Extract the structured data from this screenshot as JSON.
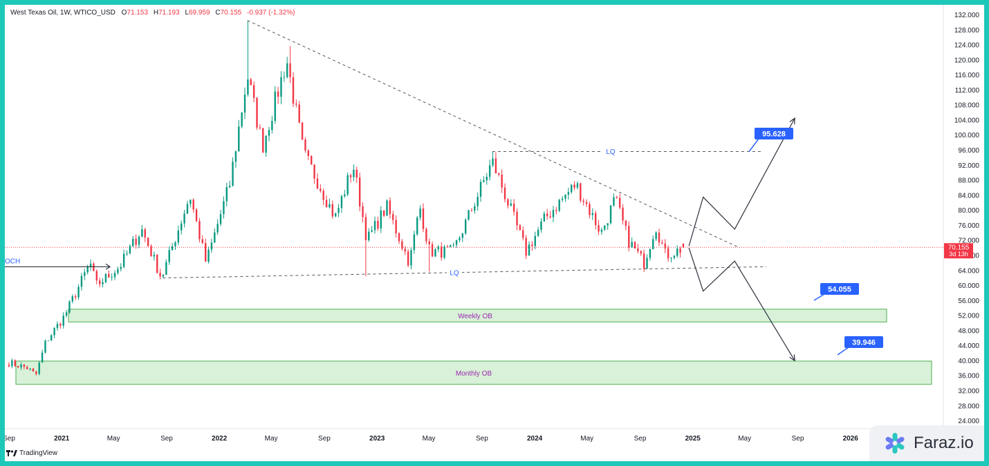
{
  "header": {
    "symbol": "West Texas Oil, 1W, WTICO_USD",
    "o_label": "O",
    "o_value": "71.153",
    "h_label": "H",
    "h_value": "71.193",
    "l_label": "L",
    "l_value": "69.959",
    "c_label": "C",
    "c_value": "70.155",
    "change": "-0.937 (-1.32%)"
  },
  "price_badge": {
    "price": "70.155",
    "countdown": "3d 13h"
  },
  "zones": {
    "weekly": {
      "label": "Weekly OB",
      "top": 53.7,
      "bottom": 50.3
    },
    "monthly": {
      "label": "Monthly OB",
      "top": 39.9,
      "bottom": 33.7
    }
  },
  "liquidity": {
    "upper_label": "LQ",
    "lower_label": "LQ"
  },
  "targets": [
    "95.628",
    "54.055",
    "39.946"
  ],
  "bos_label": "OCH",
  "brand": {
    "tradingview": "TradingView",
    "watermark": "Faraz.io"
  },
  "colors": {
    "up": "#089981",
    "down": "#f23645",
    "zone_fill": "#c8ebc8",
    "zone_border": "#4caf50",
    "label_blue": "#2962ff",
    "zone_text": "#9c27b0",
    "frame": "#1ec8b9"
  },
  "chart_data": {
    "type": "candlestick",
    "timeframe": "1W",
    "title": "West Texas Oil, 1W, WTICO_USD",
    "ylim": [
      20.8,
      133.3
    ],
    "y_ticks": [
      "132.000",
      "128.000",
      "124.000",
      "120.000",
      "116.000",
      "112.000",
      "108.000",
      "104.000",
      "100.000",
      "96.000",
      "92.000",
      "88.000",
      "84.000",
      "80.000",
      "76.000",
      "72.000",
      "68.000",
      "64.000",
      "60.000",
      "56.000",
      "52.000",
      "48.000",
      "44.000",
      "40.000",
      "36.000",
      "32.000",
      "28.000",
      "24.000"
    ],
    "x_ticks": [
      {
        "label": "Sep",
        "date": "2020-09-01"
      },
      {
        "label": "2021",
        "date": "2021-01-01"
      },
      {
        "label": "May",
        "date": "2021-05-01"
      },
      {
        "label": "Sep",
        "date": "2021-09-01"
      },
      {
        "label": "2022",
        "date": "2022-01-01"
      },
      {
        "label": "May",
        "date": "2022-05-01"
      },
      {
        "label": "Sep",
        "date": "2022-09-01"
      },
      {
        "label": "2023",
        "date": "2023-01-01"
      },
      {
        "label": "May",
        "date": "2023-05-01"
      },
      {
        "label": "Sep",
        "date": "2023-09-01"
      },
      {
        "label": "2024",
        "date": "2024-01-01"
      },
      {
        "label": "May",
        "date": "2024-05-01"
      },
      {
        "label": "Sep",
        "date": "2024-09-01"
      },
      {
        "label": "2025",
        "date": "2025-01-01"
      },
      {
        "label": "May",
        "date": "2025-05-01"
      },
      {
        "label": "Sep",
        "date": "2025-09-01"
      },
      {
        "label": "2026",
        "date": "2026-01-01"
      }
    ],
    "anchors": [
      {
        "date": "2020-09-01",
        "close": 39.5
      },
      {
        "date": "2020-10-15",
        "close": 38.0
      },
      {
        "date": "2020-11-02",
        "close": 36.0
      },
      {
        "date": "2020-11-25",
        "close": 45.0
      },
      {
        "date": "2021-01-08",
        "close": 52.0
      },
      {
        "date": "2021-03-08",
        "close": 66.0
      },
      {
        "date": "2021-03-22",
        "close": 60.0
      },
      {
        "date": "2021-05-15",
        "close": 65.0
      },
      {
        "date": "2021-07-05",
        "close": 75.0
      },
      {
        "date": "2021-08-20",
        "close": 62.0
      },
      {
        "date": "2021-10-25",
        "close": 84.0
      },
      {
        "date": "2021-12-01",
        "close": 66.0
      },
      {
        "date": "2022-01-25",
        "close": 87.0
      },
      {
        "date": "2022-03-07",
        "close": 116.0
      },
      {
        "date": "2022-04-11",
        "close": 97.0
      },
      {
        "date": "2022-06-06",
        "close": 120.0
      },
      {
        "date": "2022-07-15",
        "close": 95.0
      },
      {
        "date": "2022-08-20",
        "close": 87.0
      },
      {
        "date": "2022-09-26",
        "close": 78.0
      },
      {
        "date": "2022-11-07",
        "close": 92.0
      },
      {
        "date": "2022-12-09",
        "close": 72.0
      },
      {
        "date": "2023-01-23",
        "close": 81.0
      },
      {
        "date": "2023-03-17",
        "close": 66.0
      },
      {
        "date": "2023-04-10",
        "close": 81.0
      },
      {
        "date": "2023-05-03",
        "close": 69.0
      },
      {
        "date": "2023-06-26",
        "close": 69.0
      },
      {
        "date": "2023-09-25",
        "close": 93.0
      },
      {
        "date": "2023-10-15",
        "close": 87.0
      },
      {
        "date": "2023-12-12",
        "close": 69.0
      },
      {
        "date": "2024-01-26",
        "close": 78.0
      },
      {
        "date": "2024-04-05",
        "close": 87.0
      },
      {
        "date": "2024-06-03",
        "close": 74.0
      },
      {
        "date": "2024-07-05",
        "close": 83.0
      },
      {
        "date": "2024-08-05",
        "close": 72.0
      },
      {
        "date": "2024-09-10",
        "close": 66.0
      },
      {
        "date": "2024-10-07",
        "close": 76.0
      },
      {
        "date": "2024-10-30",
        "close": 68.0
      },
      {
        "date": "2024-12-16",
        "close": 70.155
      }
    ],
    "key_highs": [
      {
        "date": "2022-03-07",
        "high": 130.5
      },
      {
        "date": "2022-06-13",
        "high": 123.7
      },
      {
        "date": "2023-09-25",
        "high": 95.628
      }
    ],
    "key_lows": [
      {
        "date": "2021-08-23",
        "low": 62.0
      },
      {
        "date": "2022-12-05",
        "low": 62.5
      },
      {
        "date": "2023-03-20",
        "low": 64.3
      },
      {
        "date": "2023-05-01",
        "low": 63.7
      }
    ],
    "last_candle": {
      "date": "2024-12-16",
      "open": 71.153,
      "high": 71.193,
      "low": 69.959,
      "close": 70.155
    },
    "trendlines": [
      {
        "style": "dashed",
        "from": {
          "date": "2022-03-07",
          "price": 130.5
        },
        "to": {
          "date": "2025-04-20",
          "price": 70.0
        }
      },
      {
        "style": "dashed",
        "from": {
          "date": "2021-08-23",
          "price": 62.0
        },
        "to": {
          "date": "2025-06-20",
          "price": 65.0
        }
      },
      {
        "style": "dashed",
        "from": {
          "date": "2023-09-25",
          "price": 95.628
        },
        "to": {
          "date": "2025-06-10",
          "price": 95.628
        }
      }
    ],
    "projections": [
      {
        "path": [
          {
            "date": "2024-12-23",
            "price": 70.5
          },
          {
            "date": "2025-01-25",
            "price": 83.5
          },
          {
            "date": "2025-04-08",
            "price": 75.0
          },
          {
            "date": "2025-08-25",
            "price": 104.5
          }
        ],
        "target": 95.628
      },
      {
        "path": [
          {
            "date": "2024-12-23",
            "price": 70.0
          },
          {
            "date": "2025-01-25",
            "price": 58.5
          },
          {
            "date": "2025-04-08",
            "price": 66.5
          },
          {
            "date": "2025-08-25",
            "price": 40.0
          }
        ],
        "target": 39.946
      }
    ]
  }
}
